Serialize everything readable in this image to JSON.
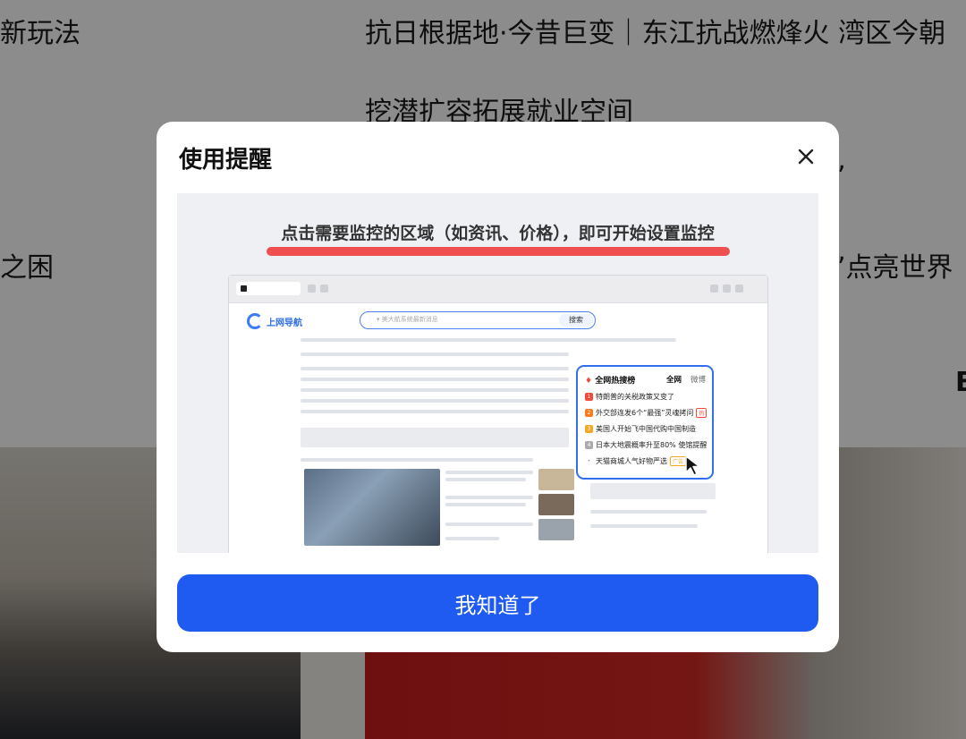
{
  "background": {
    "headlines": {
      "h1_left": "新玩法",
      "h1_right": "抗日根据地·今昔巨变｜东江抗战燃烽火 湾区今朝",
      "h2": "挖潜扩容拓展就业空间",
      "h3_left": "之困",
      "h3_right": "格”点亮世界",
      "h3_quote": "”",
      "h4_fragment": "B"
    }
  },
  "modal": {
    "title": "使用提醒",
    "close_icon": "close-icon",
    "hint": "点击需要监控的区域（如资讯、价格），即可开始设置监控",
    "preview": {
      "logo_text": "上网导航",
      "search_placeholder": "▾ 美大航系统最新消息",
      "search_button": "搜索",
      "hot_panel": {
        "title": "全网热搜榜",
        "tab_all": "全网",
        "tab_weibo": "微博",
        "items": [
          {
            "rank": "1",
            "text": "特朗普的关税政策又变了",
            "tag": "",
            "color": "#f24b3a"
          },
          {
            "rank": "2",
            "text": "外交部连发6个“最强”灵魂拷问",
            "tag": "热",
            "color": "#ff7a1a"
          },
          {
            "rank": "3",
            "text": "美国人开始飞中国代购中国制造",
            "tag": "",
            "color": "#f5a623"
          },
          {
            "rank": "4",
            "text": "日本大地震概率升至80% 使馆提醒",
            "tag": "",
            "color": "#aaaaaa"
          },
          {
            "rank": "•",
            "text": "天猫商城人气好物严选",
            "tag": "广告",
            "color": "#bbbbbb"
          }
        ]
      }
    },
    "confirm_button": "我知道了"
  },
  "colors": {
    "primary": "#1f5bf0",
    "underline": "#ef4f4f",
    "overlay": "rgba(0,0,0,0.45)"
  }
}
